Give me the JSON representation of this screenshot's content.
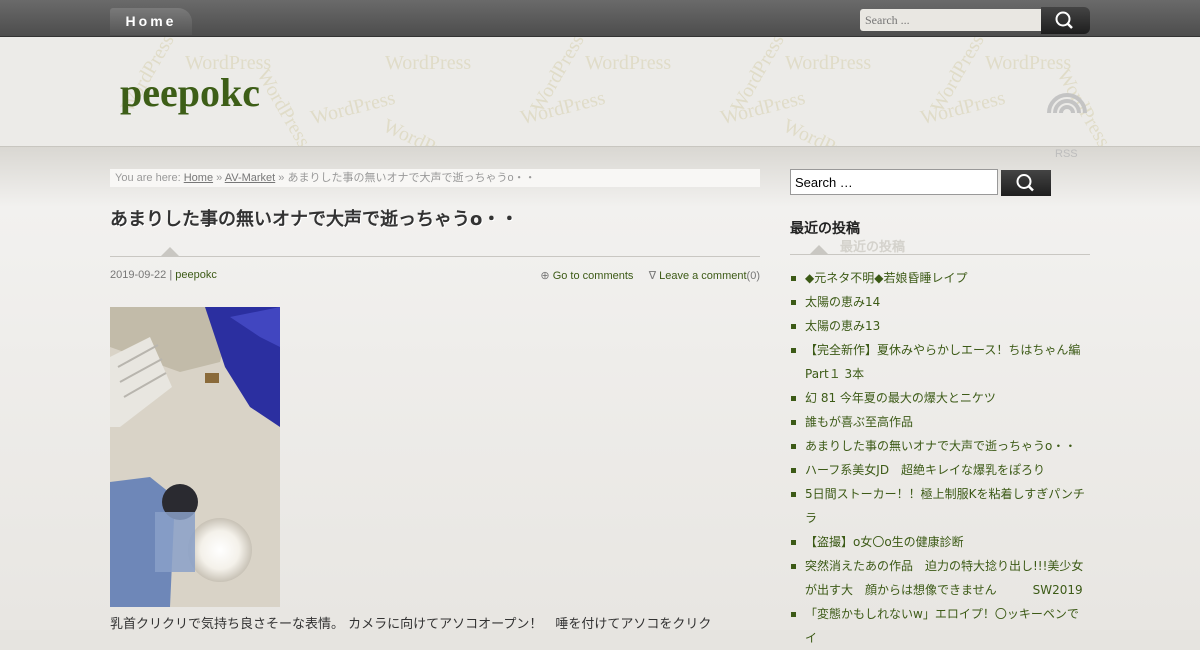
{
  "nav": {
    "home_label": "Home"
  },
  "top_search": {
    "placeholder": "Search ..."
  },
  "header": {
    "site_title": "peepokc",
    "watermark_text": "WordPress",
    "rss_label": "RSS"
  },
  "breadcrumb": {
    "prefix": "You are here:",
    "home": "Home",
    "sep1": "»",
    "category": "AV-Market",
    "sep2": "»",
    "current": "あまりした事の無いオナで大声で逝っちゃうo・・"
  },
  "post": {
    "title": "あまりした事の無いオナで大声で逝っちゃうo・・",
    "date": "2019-09-22",
    "meta_sep": "|",
    "author": "peepokc",
    "comments_symbol": "⊕",
    "go_to_comments": "Go to comments",
    "leave_symbol": "∇",
    "leave_comment": "Leave a comment",
    "comment_count": "(0)",
    "excerpt": "乳首クリクリで気持ち良さそーな表情。 カメラに向けてアソコオープン！　唾を付けてアソコをクリク"
  },
  "sidebar": {
    "search_value": "Search …",
    "recent_heading": "最近の投稿",
    "recent_posts": [
      "◆元ネタ不明◆若娘昏睡レイプ",
      "太陽の恵み14",
      "太陽の恵み13",
      "【完全新作】夏休みやらかしエース！ちはちゃん編Part１ 3本",
      "幻 81 今年夏の最大の爆大とニケツ",
      "誰もが喜ぶ至高作品",
      "あまりした事の無いオナで大声で逝っちゃうo・・",
      "ハーフ系美女JD　超絶キレイな爆乳をぽろり",
      "5日間ストーカー！！極上制服Kを粘着しすぎパンチラ",
      "【盗撮】o女〇o生の健康診断",
      "突然消えたあの作品　迫力の特大捻り出し!!!美少女が出す大　顔からは想像できません　　　SW2019",
      "「変態かもしれないw」エロイプ！〇ッキーペンでイ"
    ]
  }
}
